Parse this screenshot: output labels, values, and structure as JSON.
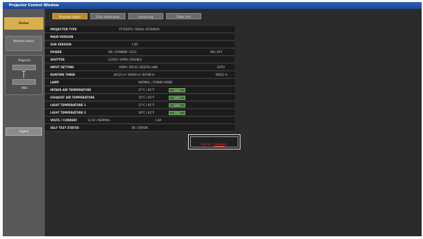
{
  "window": {
    "title": "Projector Control Window"
  },
  "sidebar": {
    "status_label": "Status",
    "network_label": "Network status",
    "projector_label": "Projector",
    "projector_sub": "Web",
    "logout_label": "Logout"
  },
  "tabs": [
    {
      "label": "Projector status"
    },
    {
      "label": "Error information"
    },
    {
      "label": "Access log"
    },
    {
      "label": "Other info"
    }
  ],
  "status_rows": [
    {
      "label": "PROJECTOR TYPE",
      "value": "PT-RZ970 / SERIAL 4F5A9920"
    },
    {
      "label": "MAIN VERSION",
      "value": ""
    },
    {
      "label": "SUB VERSION",
      "value": "1.00"
    },
    {
      "label": "POWER",
      "value": "ON / STANDBY / ECO",
      "value2": "ON / OFF"
    },
    {
      "label": "SHUTTER",
      "value": "CLOSE / OPEN / DISABLE"
    },
    {
      "label": "INPUT SETTING",
      "value": "HDMI / DVI-D / DIGITAL LINK",
      "value2": "AUTO"
    },
    {
      "label": "RUNTIME TIMER",
      "value": "00123 H / 00456 H / 00789 H",
      "value2": "00012 H"
    },
    {
      "label": "LAMP",
      "value": "NORMAL / POWER MODE"
    },
    {
      "label": "INTAKE AIR TEMPERATURE",
      "value": "27°C / 81°F",
      "ok": "GOOD"
    },
    {
      "label": "EXHAUST AIR TEMPERATURE",
      "value": "35°C / 95°F",
      "ok": "GOOD"
    },
    {
      "label": "LIGHT TEMPERATURE 1",
      "value": "27°C / 81°F",
      "ok": "GOOD"
    },
    {
      "label": "LIGHT TEMPERATURE 2",
      "value": "28°C / 82°F",
      "ok": "GOOD"
    },
    {
      "label": "VOLTS / CURRENT",
      "value": "12.0V  /  NORMAL",
      "value2": "1.0A"
    },
    {
      "label": "SELF TEST STATUS",
      "value": "OK  /  ERROR"
    }
  ],
  "error_button": {
    "label": "Error (",
    "link": "Detail",
    "suffix": ")"
  }
}
